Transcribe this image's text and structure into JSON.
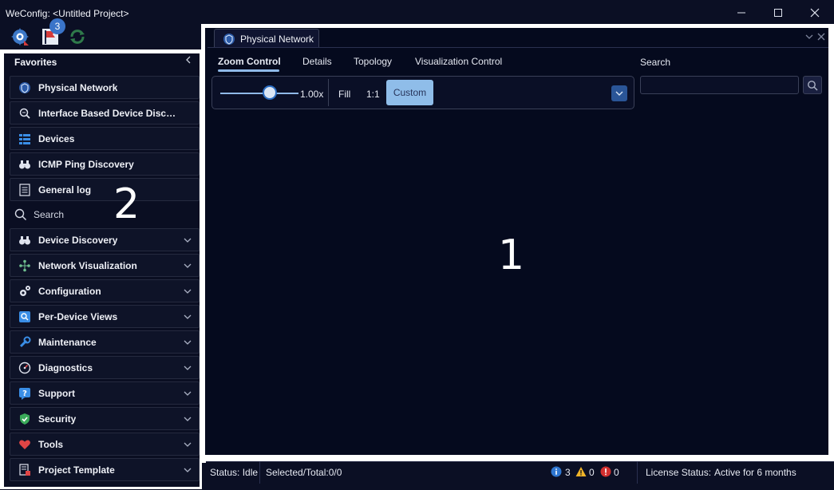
{
  "window": {
    "title": "WeConfig: <Untitled Project>"
  },
  "toolbar": {
    "notification_count": "3",
    "icons": [
      "settings-gear-icon",
      "flag-icon",
      "refresh-icon"
    ]
  },
  "sidebar": {
    "header": "Favorites",
    "favorites": [
      {
        "label": "Physical Network",
        "icon": "physical-network-icon"
      },
      {
        "label": "Interface Based Device Discovery",
        "icon": "magnifier-icon"
      },
      {
        "label": "Devices",
        "icon": "grid-icon"
      },
      {
        "label": "ICMP Ping Discovery",
        "icon": "binoculars-icon"
      },
      {
        "label": "General log",
        "icon": "log-icon"
      }
    ],
    "search_label": "Search",
    "groups": [
      {
        "label": "Device Discovery",
        "icon": "binoculars-icon"
      },
      {
        "label": "Network Visualization",
        "icon": "network-icon"
      },
      {
        "label": "Configuration",
        "icon": "gears-icon"
      },
      {
        "label": "Per-Device Views",
        "icon": "device-view-icon"
      },
      {
        "label": "Maintenance",
        "icon": "wrench-icon"
      },
      {
        "label": "Diagnostics",
        "icon": "gauge-icon"
      },
      {
        "label": "Support",
        "icon": "help-icon"
      },
      {
        "label": "Security",
        "icon": "shield-icon"
      },
      {
        "label": "Tools",
        "icon": "heart-icon"
      },
      {
        "label": "Project Template",
        "icon": "template-icon"
      }
    ]
  },
  "main": {
    "tab_label": "Physical Network",
    "subtabs": [
      "Zoom Control",
      "Details",
      "Topology",
      "Visualization Control"
    ],
    "search_label": "Search",
    "search_value": "",
    "zoom": {
      "value_label": "1.00x",
      "fill_label": "Fill",
      "one_to_one_label": "1:1",
      "custom_label": "Custom",
      "slider_fraction": 0.64
    }
  },
  "overlays": {
    "area1": "1",
    "area2": "2"
  },
  "statusbar": {
    "status": "Status: Idle",
    "selected": "Selected/Total:0/0",
    "info_count": "3",
    "warning_count": "0",
    "error_count": "0",
    "license_label": "License Status:",
    "license_value": "Active for 6 months"
  },
  "colors": {
    "accent": "#8fbde9",
    "badge": "#3a74c9",
    "background": "#0b0f24"
  }
}
